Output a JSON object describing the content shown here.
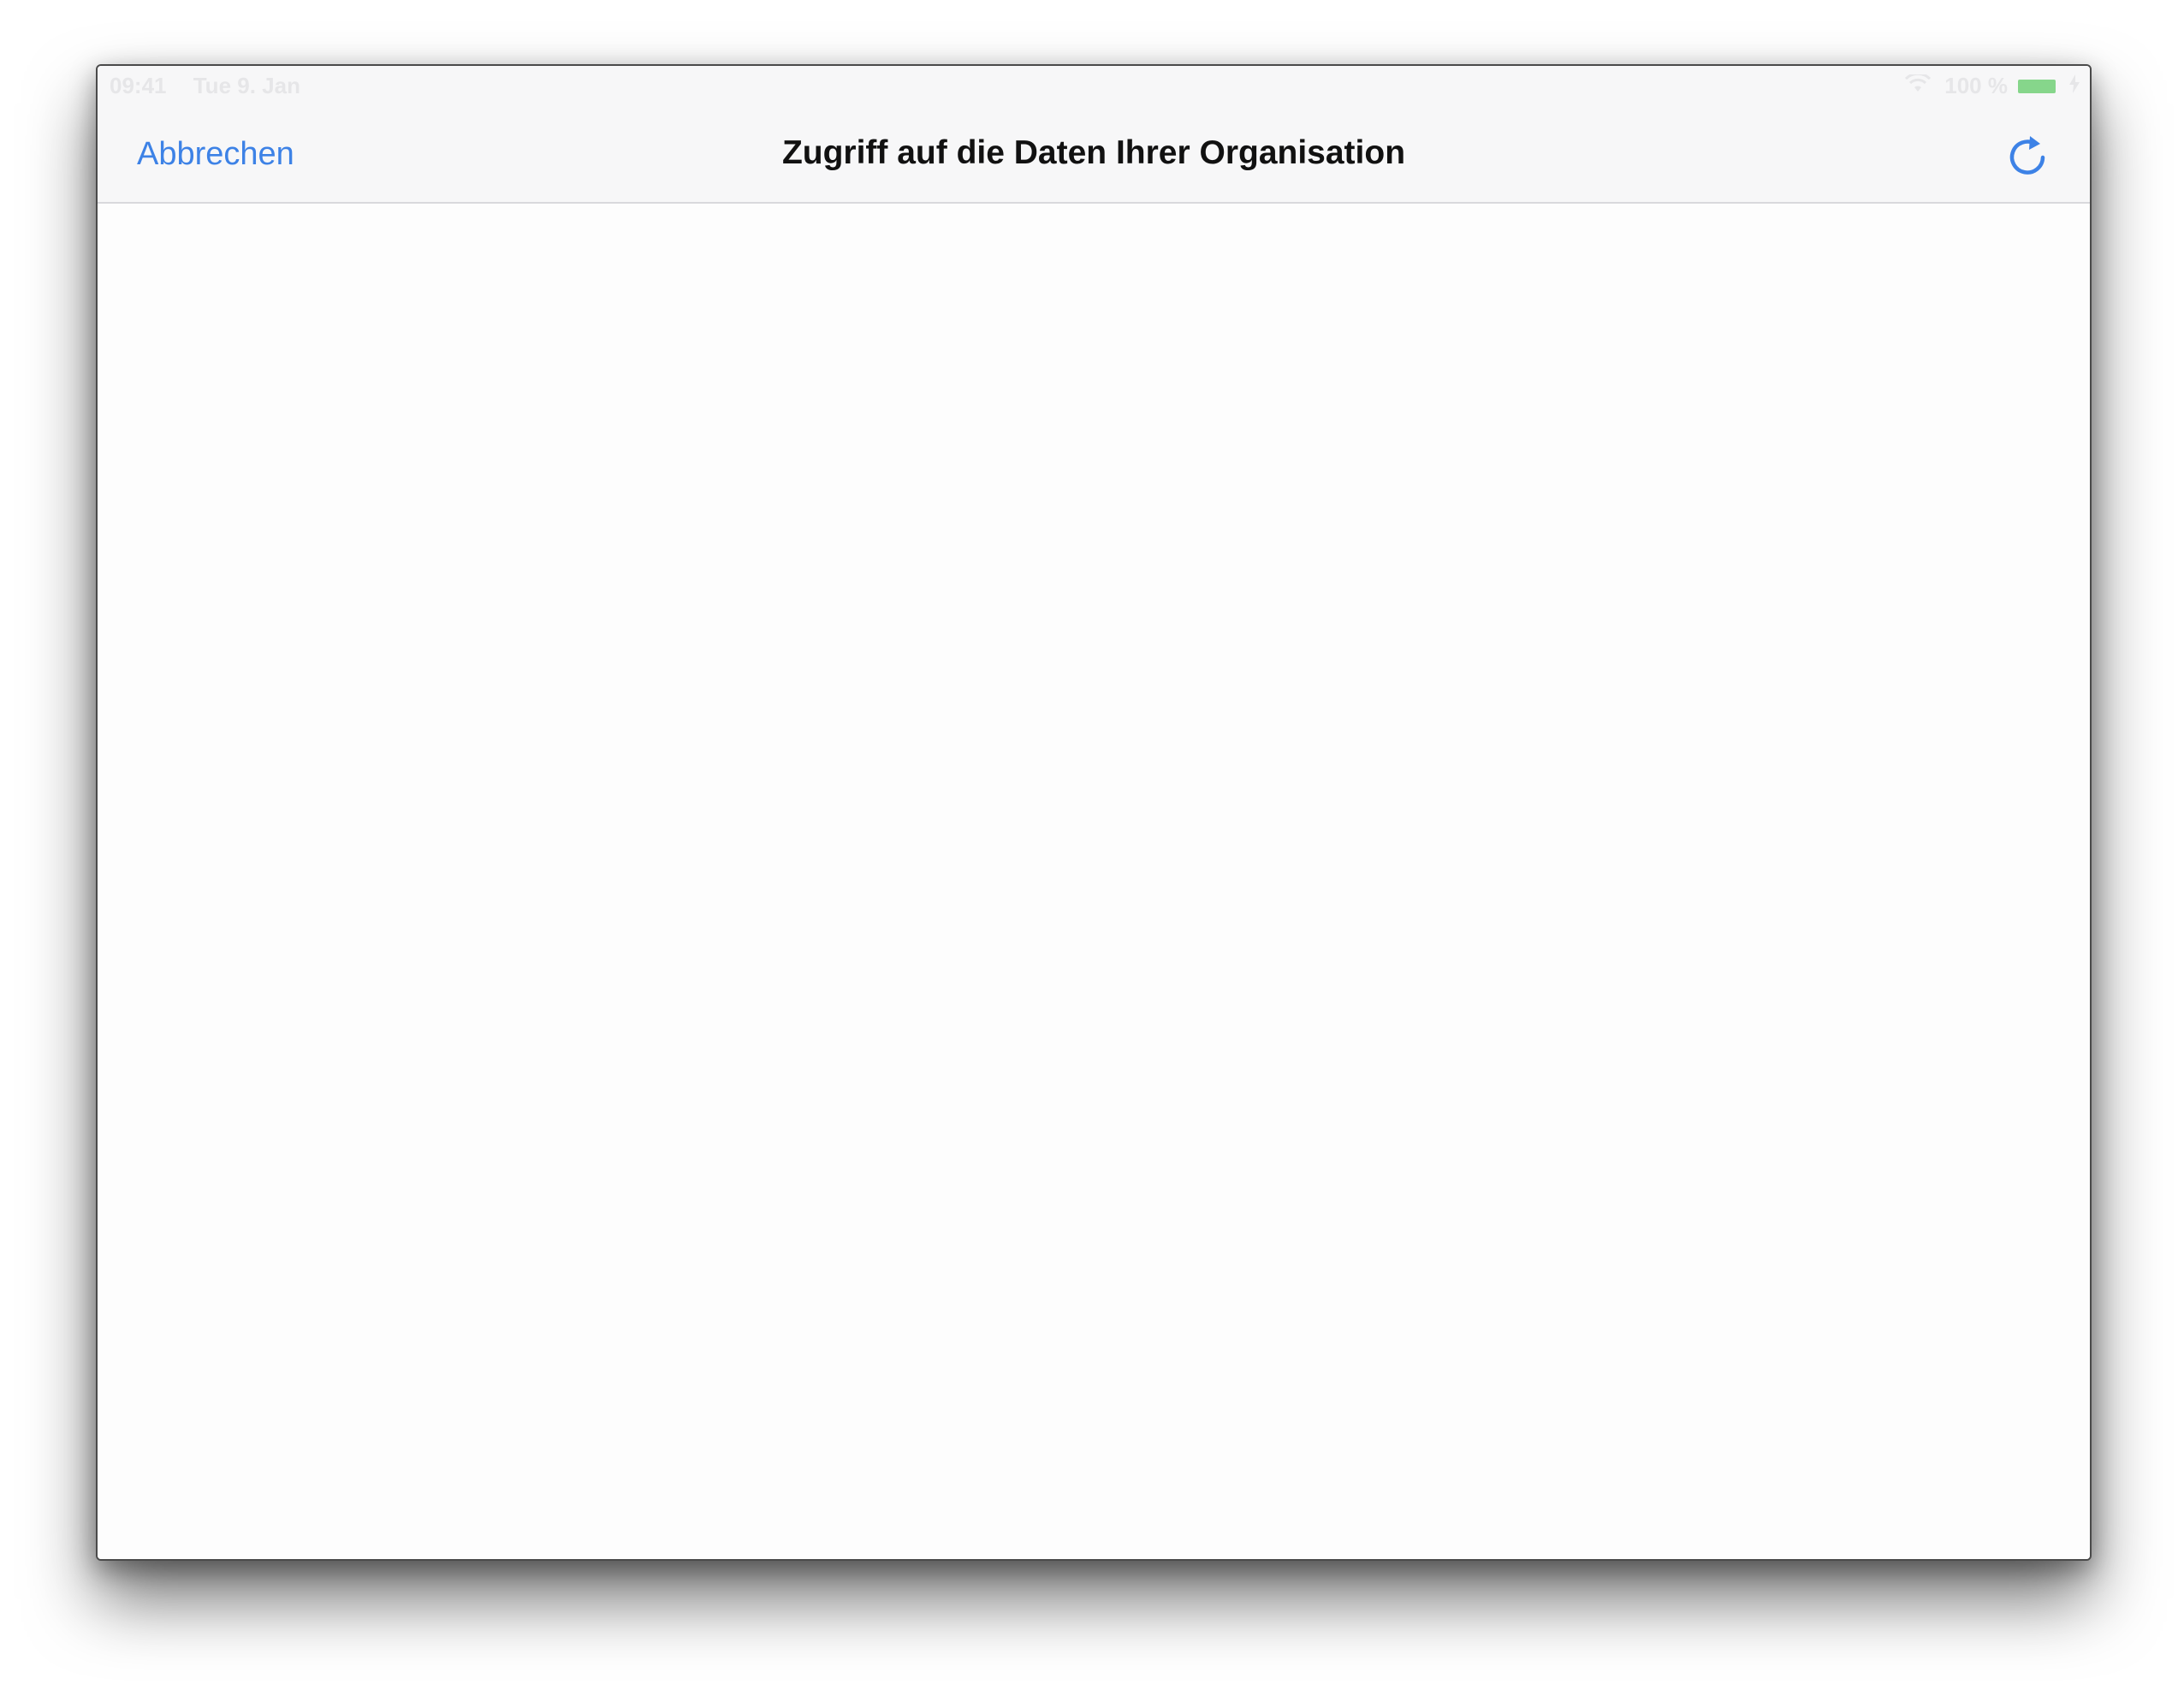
{
  "status_bar": {
    "time": "09:41",
    "date": "Tue 9. Jan",
    "battery_percent": "100 %",
    "battery_color": "#86d68b"
  },
  "nav_bar": {
    "cancel_label": "Abbrechen",
    "title": "Zugriff auf die Daten Ihrer Organisation",
    "refresh_icon": "refresh-icon"
  },
  "colors": {
    "accent": "#3d82e6",
    "title_text": "#111111",
    "bar_background": "#f7f7f8"
  }
}
